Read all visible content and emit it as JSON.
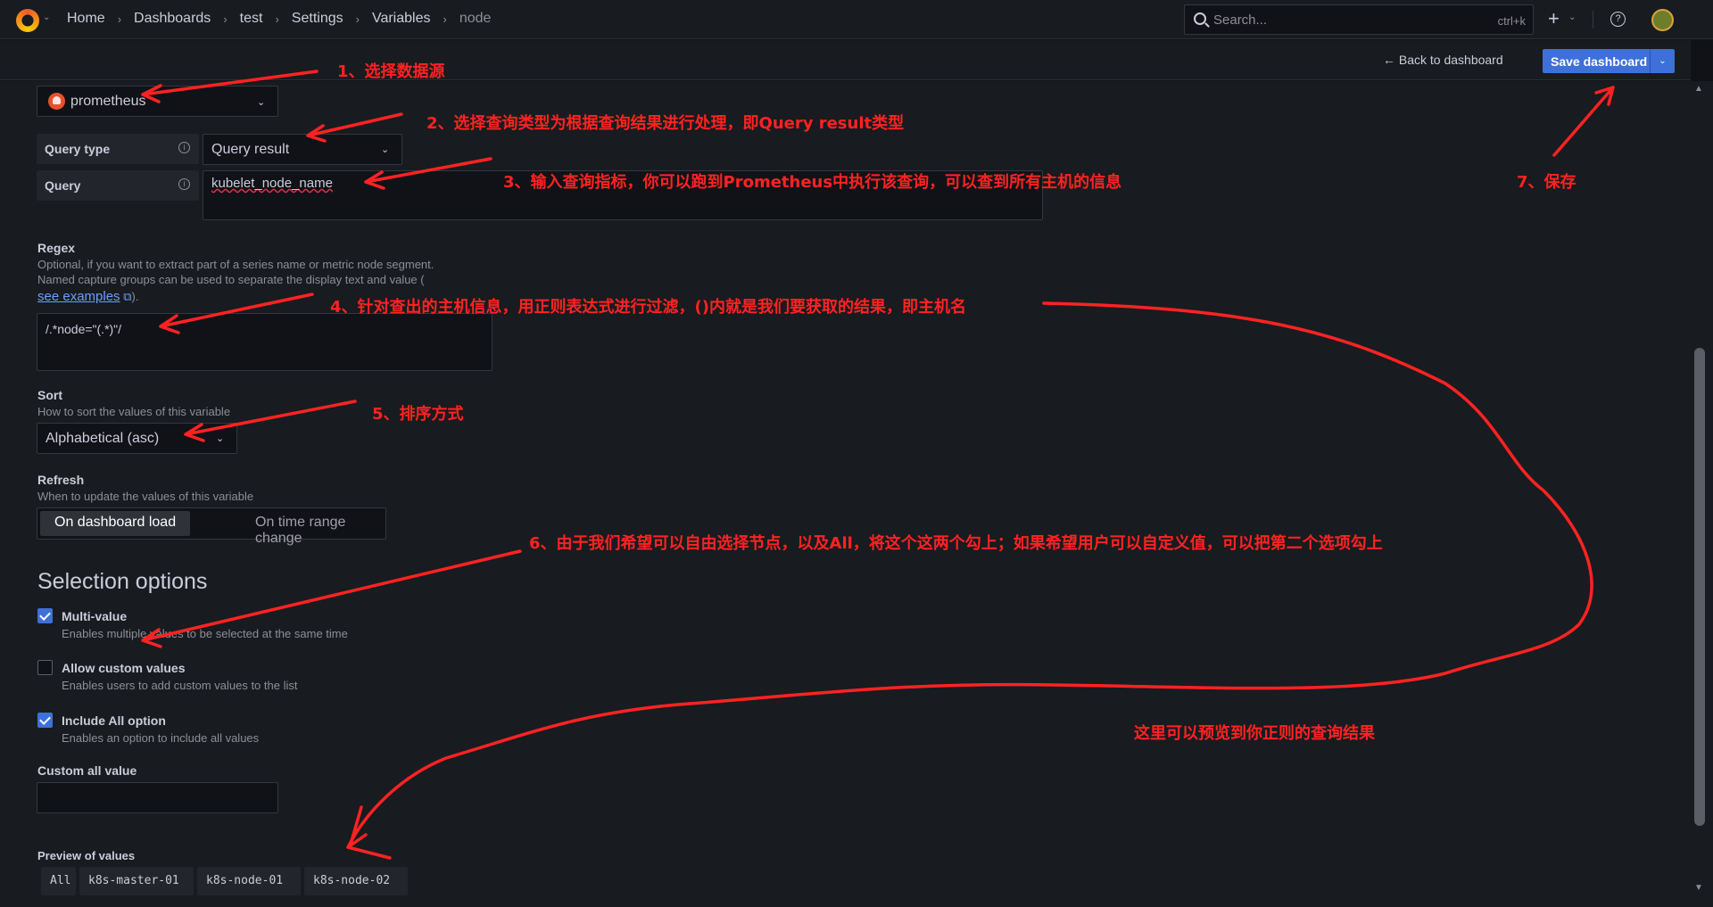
{
  "breadcrumb": {
    "items": [
      "Home",
      "Dashboards",
      "test",
      "Settings",
      "Variables",
      "node"
    ]
  },
  "search": {
    "placeholder": "Search...",
    "shortcut": "ctrl+k"
  },
  "subbar": {
    "back_label": "Back to dashboard",
    "save_label": "Save dashboard"
  },
  "datasource": {
    "name": "prometheus"
  },
  "query": {
    "type_label": "Query type",
    "type_value": "Query result",
    "label": "Query",
    "value": "kubelet_node_name"
  },
  "regex": {
    "label": "Regex",
    "desc1": "Optional, if you want to extract part of a series name or metric node segment.",
    "desc2_prefix": "Named capture groups can be used to separate the display text and value (",
    "link": "see examples",
    "link_suffix": ").",
    "value": "/.*node=\"(.*)\"/"
  },
  "sort": {
    "label": "Sort",
    "desc": "How to sort the values of this variable",
    "value": "Alphabetical (asc)"
  },
  "refresh": {
    "label": "Refresh",
    "desc": "When to update the values of this variable",
    "options": [
      "On dashboard load",
      "On time range change"
    ],
    "selected": "On dashboard load"
  },
  "selection": {
    "title": "Selection options",
    "options": [
      {
        "title": "Multi-value",
        "desc": "Enables multiple values to be selected at the same time",
        "checked": true
      },
      {
        "title": "Allow custom values",
        "desc": "Enables users to add custom values to the list",
        "checked": false
      },
      {
        "title": "Include All option",
        "desc": "Enables an option to include all values",
        "checked": true
      }
    ],
    "custom_all_label": "Custom all value",
    "custom_all_value": ""
  },
  "preview": {
    "label": "Preview of values",
    "values": [
      "All",
      "k8s-master-01",
      "k8s-node-01",
      "k8s-node-02"
    ]
  },
  "annotations": {
    "a1": "1、选择数据源",
    "a2": "2、选择查询类型为根据查询结果进行处理，即Query result类型",
    "a3": "3、输入查询指标，你可以跑到Prometheus中执行该查询，可以查到所有主机的信息",
    "a4": "4、针对查出的主机信息，用正则表达式进行过滤，()内就是我们要获取的结果，即主机名",
    "a5": "5、排序方式",
    "a6": "6、由于我们希望可以自由选择节点，以及All，将这个这两个勾上；如果希望用户可以自定义值，可以把第二个选项勾上",
    "a7": "7、保存",
    "a8": "这里可以预览到你正则的查询结果"
  },
  "colors": {
    "accent": "#3d71d9",
    "annotation": "#ff2222",
    "background": "#181b1f"
  }
}
